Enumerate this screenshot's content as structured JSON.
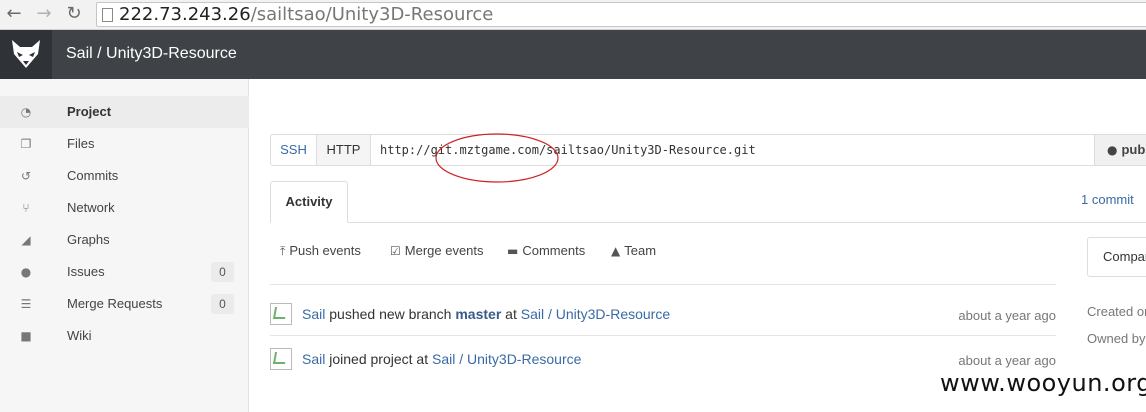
{
  "browser": {
    "back_icon": "arrow-left-icon",
    "forward_icon": "arrow-right-icon",
    "reload_icon": "reload-icon",
    "url_host": "222.73.243.26",
    "url_path": "/sailtsao/Unity3D-Resource"
  },
  "header": {
    "logo": "gitlab-fox-logo",
    "title": "Sail / Unity3D-Resource"
  },
  "sidebar": {
    "items": [
      {
        "label": "Project",
        "icon": "dashboard-icon",
        "active": true
      },
      {
        "label": "Files",
        "icon": "files-icon"
      },
      {
        "label": "Commits",
        "icon": "history-icon"
      },
      {
        "label": "Network",
        "icon": "branch-icon"
      },
      {
        "label": "Graphs",
        "icon": "area-chart-icon"
      },
      {
        "label": "Issues",
        "icon": "exclamation-icon",
        "count": "0"
      },
      {
        "label": "Merge Requests",
        "icon": "list-icon",
        "count": "0"
      },
      {
        "label": "Wiki",
        "icon": "book-icon"
      }
    ]
  },
  "clone": {
    "ssh_label": "SSH",
    "http_label": "HTTP",
    "url": "http://git.mztgame.com/sailtsao/Unity3D-Resource.git",
    "visibility_label": "pub"
  },
  "tabs": {
    "activity_label": "Activity",
    "commit_link": "1 commit"
  },
  "filters": [
    {
      "label": "Push events",
      "icon": "upload-icon"
    },
    {
      "label": "Merge events",
      "icon": "check-square-icon"
    },
    {
      "label": "Comments",
      "icon": "comments-icon"
    },
    {
      "label": "Team",
      "icon": "user-icon"
    }
  ],
  "events": [
    {
      "author": "Sail",
      "action": "pushed new branch",
      "branch": "master",
      "preposition": "at",
      "project": "Sail / Unity3D-Resource",
      "time": "about a year ago"
    },
    {
      "author": "Sail",
      "action": "joined project",
      "preposition": "at",
      "project": "Sail / Unity3D-Resource",
      "time": "about a year ago"
    }
  ],
  "right_panel": {
    "compare_label": "Compar",
    "created_label": "Created or",
    "owned_label": "Owned by"
  },
  "watermark": "www.wooyun.org",
  "colors": {
    "header": "#3f4247",
    "link": "#3a6aa5",
    "highlight": "#cc2222"
  }
}
